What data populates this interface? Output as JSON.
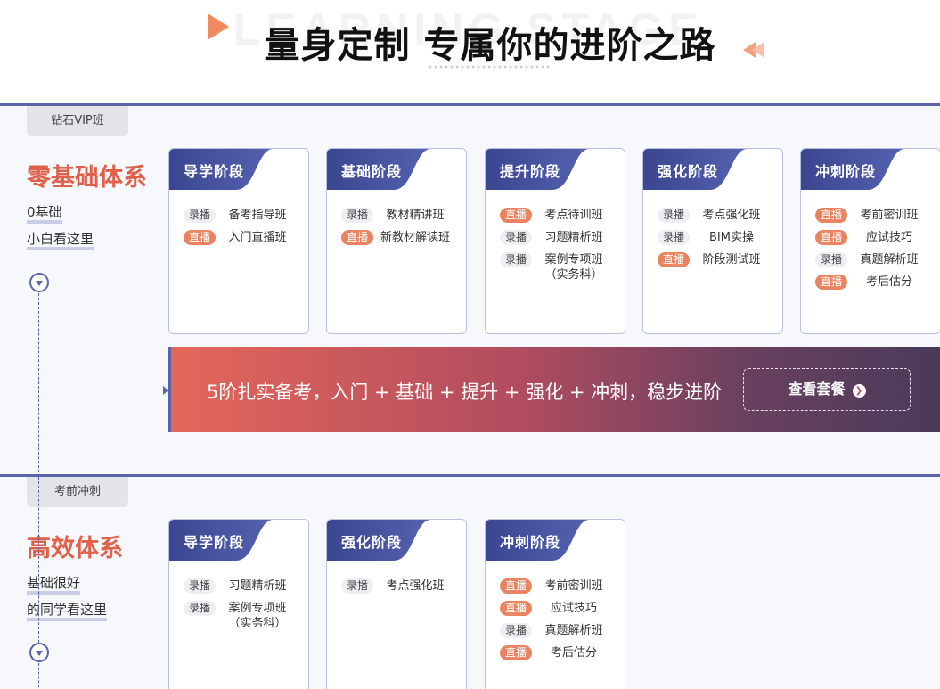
{
  "header": {
    "watermark": "LEARNING STAGE",
    "title": "量身定制 专属你的进阶之路"
  },
  "sections": [
    {
      "tab": "钻石VIP班",
      "title": "零基础体系",
      "lines": [
        "0基础",
        "小白看这里"
      ],
      "cards": [
        {
          "stage": "导学阶段",
          "rows": [
            {
              "tag": "录播",
              "type": "rec",
              "course": "备考指导班"
            },
            {
              "tag": "直播",
              "type": "live",
              "course": "入门直播班"
            }
          ]
        },
        {
          "stage": "基础阶段",
          "rows": [
            {
              "tag": "录播",
              "type": "rec",
              "course": "教材精讲班"
            },
            {
              "tag": "直播",
              "type": "live",
              "course": "新教材解读班"
            }
          ]
        },
        {
          "stage": "提升阶段",
          "rows": [
            {
              "tag": "直播",
              "type": "live",
              "course": "考点待训班"
            },
            {
              "tag": "录播",
              "type": "rec",
              "course": "习题精析班"
            },
            {
              "tag": "录播",
              "type": "rec",
              "course": "案例专项班\n（实务科）"
            }
          ]
        },
        {
          "stage": "强化阶段",
          "rows": [
            {
              "tag": "录播",
              "type": "rec",
              "course": "考点强化班"
            },
            {
              "tag": "录播",
              "type": "rec",
              "course": "BIM实操"
            },
            {
              "tag": "直播",
              "type": "live",
              "course": "阶段测试班"
            }
          ]
        },
        {
          "stage": "冲刺阶段",
          "rows": [
            {
              "tag": "直播",
              "type": "live",
              "course": "考前密训班"
            },
            {
              "tag": "直播",
              "type": "live",
              "course": "应试技巧"
            },
            {
              "tag": "录播",
              "type": "rec",
              "course": "真题解析班"
            },
            {
              "tag": "直播",
              "type": "live",
              "course": "考后估分"
            }
          ]
        }
      ],
      "banner": {
        "text": "5阶扎实备考，入门 + 基础 + 提升 + 强化 + 冲刺，稳步进阶",
        "button": "查看套餐"
      }
    },
    {
      "tab": "考前冲刺",
      "title": "高效体系",
      "lines": [
        "基础很好",
        "的同学看这里"
      ],
      "cards": [
        {
          "stage": "导学阶段",
          "rows": [
            {
              "tag": "录播",
              "type": "rec",
              "course": "习题精析班"
            },
            {
              "tag": "录播",
              "type": "rec",
              "course": "案例专项班\n（实务科）"
            }
          ]
        },
        {
          "stage": "强化阶段",
          "rows": [
            {
              "tag": "录播",
              "type": "rec",
              "course": "考点强化班"
            }
          ]
        },
        {
          "stage": "冲刺阶段",
          "rows": [
            {
              "tag": "直播",
              "type": "live",
              "course": "考前密训班"
            },
            {
              "tag": "直播",
              "type": "live",
              "course": "应试技巧"
            },
            {
              "tag": "录播",
              "type": "rec",
              "course": "真题解析班"
            },
            {
              "tag": "直播",
              "type": "live",
              "course": "考后估分"
            }
          ]
        }
      ]
    }
  ],
  "colors": {
    "accent": "#e0614b",
    "navy": "#3f4a96",
    "live": "#ec8360",
    "rec_bg": "#eeeff3",
    "border": "#5a64a8"
  }
}
